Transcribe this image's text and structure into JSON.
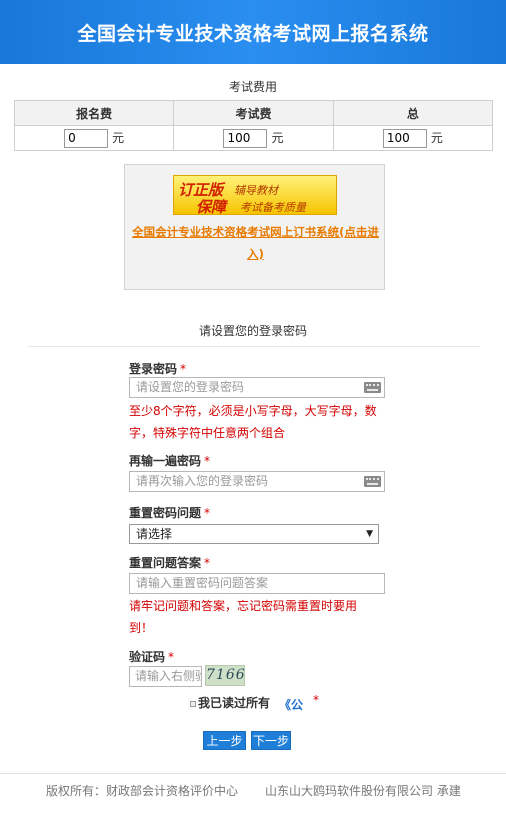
{
  "header": {
    "title": "全国会计专业技术资格考试网上报名系统"
  },
  "fees": {
    "caption": "考试费用",
    "columns": [
      "报名费",
      "考试费",
      "总"
    ],
    "values": [
      "0",
      "100",
      "100"
    ],
    "unit": "元"
  },
  "ad": {
    "banner_line1_big": "订正版",
    "banner_line1_small": "辅导教材",
    "banner_line2_big": "保障",
    "banner_line2_small": "考试备考质量",
    "link_text": "全国会计专业技术资格考试网上订书系统(点击进入)"
  },
  "form": {
    "section_title": "请设置您的登录密码",
    "required_mark": "*",
    "password": {
      "label": "登录密码",
      "placeholder": "请设置您的登录密码",
      "hint": "至少8个字符，必须是小写字母，大写字母，数字，特殊字符中任意两个组合"
    },
    "password_confirm": {
      "label": "再输一遍密码",
      "placeholder": "请再次输入您的登录密码"
    },
    "reset_question": {
      "label": "重置密码问题",
      "selected": "请选择"
    },
    "reset_answer": {
      "label": "重置问题答案",
      "placeholder": "请输入重置密码问题答案",
      "hint": "请牢记问题和答案，忘记密码需重置时要用到！"
    },
    "captcha": {
      "label": "验证码",
      "placeholder": "请输入右侧验证码",
      "image_text": "7166"
    },
    "agree": {
      "text": "我已读过所有",
      "link": "《公"
    },
    "buttons": {
      "prev": "上一步",
      "next": "下一步"
    }
  },
  "footer": {
    "copyright": "版权所有：财政部会计资格评价中心",
    "developer": "山东山大鸥玛软件股份有限公司 承建"
  },
  "colors": {
    "header_blue": "#1f84e6",
    "button_blue": "#1f7fd8",
    "required_red": "#d40000",
    "link_orange": "#e87a00",
    "link_blue": "#1f6fd0"
  }
}
